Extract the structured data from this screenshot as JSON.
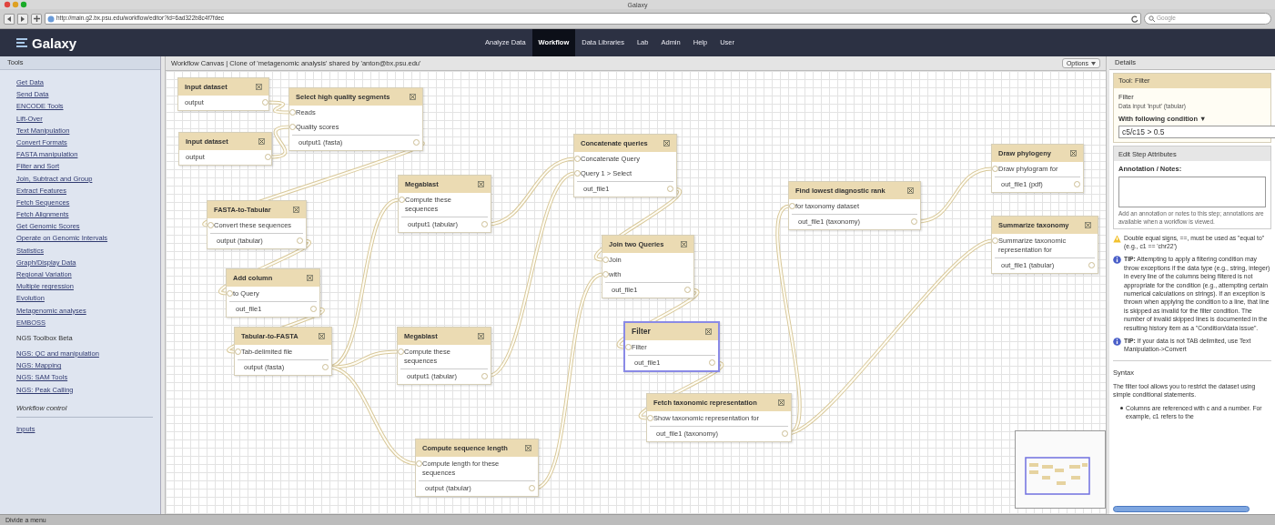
{
  "browser": {
    "title": "Galaxy",
    "url": "http://main.g2.bx.psu.edu/workflow/editor?id=6ad322b8c4f7fdec",
    "search_placeholder": "Google"
  },
  "masthead": {
    "brand": "Galaxy",
    "nav": [
      {
        "label": "Analyze Data",
        "selected": false
      },
      {
        "label": "Workflow",
        "selected": true
      },
      {
        "label": "Data Libraries",
        "selected": false
      },
      {
        "label": "Lab",
        "selected": false
      },
      {
        "label": "Admin",
        "selected": false
      },
      {
        "label": "Help",
        "selected": false
      },
      {
        "label": "User",
        "selected": false
      }
    ]
  },
  "tools_panel": {
    "title": "Tools",
    "sections": [
      {
        "items": [
          "Get Data",
          "Send Data",
          "ENCODE Tools",
          "Lift-Over",
          "Text Manipulation",
          "Convert Formats",
          "FASTA manipulation",
          "Filter and Sort",
          "Join, Subtract and Group",
          "Extract Features",
          "Fetch Sequences",
          "Fetch Alignments",
          "Get Genomic Scores",
          "Operate on Genomic Intervals",
          "Statistics",
          "Graph/Display Data",
          "Regional Variation",
          "Multiple regression",
          "Evolution",
          "Metagenomic analyses",
          "EMBOSS"
        ]
      },
      {
        "heading": "NGS Toolbox Beta",
        "items": [
          "NGS: QC and manipulation",
          "NGS: Mapping",
          "NGS: SAM Tools",
          "NGS: Peak Calling"
        ]
      },
      {
        "heading": "Workflow control",
        "items": [
          "Inputs"
        ]
      }
    ]
  },
  "canvas": {
    "title": "Workflow Canvas | Clone of 'metagenomic analysis' shared by 'anton@bx.psu.edu'",
    "options_button": "Options",
    "nodes": [
      {
        "title": "Input dataset",
        "outputs": [
          "output"
        ],
        "selected": false
      },
      {
        "title": "Input dataset",
        "outputs": [
          "output"
        ],
        "selected": false
      },
      {
        "title": "Select high quality segments",
        "inputs": [
          "Reads",
          "Quality scores"
        ],
        "outputs": [
          "output1 (fasta)"
        ],
        "selected": false
      },
      {
        "title": "FASTA-to-Tabular",
        "inputs": [
          "Convert these sequences"
        ],
        "outputs": [
          "output (tabular)"
        ],
        "selected": false
      },
      {
        "title": "Add column",
        "inputs": [
          "to Query"
        ],
        "outputs": [
          "out_file1"
        ],
        "selected": false
      },
      {
        "title": "Tabular-to-FASTA",
        "inputs": [
          "Tab-delimited file"
        ],
        "outputs": [
          "output (fasta)"
        ],
        "selected": false
      },
      {
        "title": "Megablast",
        "inputs": [
          "Compute these sequences"
        ],
        "outputs": [
          "output1 (tabular)"
        ],
        "selected": false
      },
      {
        "title": "Megablast",
        "inputs": [
          "Compute these sequences"
        ],
        "outputs": [
          "output1 (tabular)"
        ],
        "selected": false
      },
      {
        "title": "Compute sequence length",
        "inputs": [
          "Compute length for these sequences"
        ],
        "outputs": [
          "output (tabular)"
        ],
        "selected": false
      },
      {
        "title": "Concatenate queries",
        "inputs": [
          "Concatenate Query",
          "Query 1 > Select"
        ],
        "outputs": [
          "out_file1"
        ],
        "selected": false
      },
      {
        "title": "Join two Queries",
        "inputs": [
          "Join",
          "with"
        ],
        "outputs": [
          "out_file1"
        ],
        "selected": false
      },
      {
        "title": "Filter",
        "inputs": [
          "Filter"
        ],
        "outputs": [
          "out_file1"
        ],
        "selected": true
      },
      {
        "title": "Fetch taxonomic representation",
        "inputs": [
          "Show taxonomic representation for"
        ],
        "outputs": [
          "out_file1 (taxonomy)"
        ],
        "selected": false
      },
      {
        "title": "Find lowest diagnostic rank",
        "inputs": [
          "for taxonomy dataset"
        ],
        "outputs": [
          "out_file1 (taxonomy)"
        ],
        "selected": false
      },
      {
        "title": "Draw phylogeny",
        "inputs": [
          "Draw phylogram for"
        ],
        "outputs": [
          "out_file1 (pdf)"
        ],
        "selected": false
      },
      {
        "title": "Summarize taxonomy",
        "inputs": [
          "Summarize taxonomic representation for"
        ],
        "outputs": [
          "out_file1 (tabular)"
        ],
        "selected": false
      }
    ]
  },
  "details": {
    "title": "Details",
    "tool_card": {
      "title": "Tool: Filter",
      "name": "Filter",
      "input_label": "Data input 'input' (tabular)",
      "condition_label": "With following condition ▼",
      "condition_value": "c5/c15 > 0.5"
    },
    "step_attributes": {
      "title": "Edit Step Attributes",
      "annotation_label": "Annotation / Notes:",
      "annotation_help": "Add an annotation or notes to this step; annotations are available when a workflow is viewed."
    },
    "notes": [
      {
        "kind": "warning",
        "text": "Double equal signs, ==, must be used as \"equal to\" (e.g., c1 == 'chr22')"
      },
      {
        "kind": "tip",
        "text": "**TIP:** Attempting to apply a filtering condition may throw exceptions if the data type (e.g., string, integer) in every line of the columns being filtered is not appropriate for the condition (e.g., attempting certain numerical calculations on strings). If an exception is thrown when applying the condition to a line, that line is skipped as invalid for the filter condition. The number of invalid skipped lines is documented in the resulting history item as a \"Condition/data issue\"."
      },
      {
        "kind": "tip",
        "text": "**TIP:** If your data is not TAB delimited, use Text Manipulation->Convert"
      }
    ],
    "syntax": {
      "title": "Syntax",
      "text": "The filter tool allows you to restrict the dataset using simple conditional statements.",
      "bullets": [
        "Columns are referenced with c and a number. For example, c1 refers to the"
      ]
    }
  },
  "status_bar": "Divide a menu"
}
